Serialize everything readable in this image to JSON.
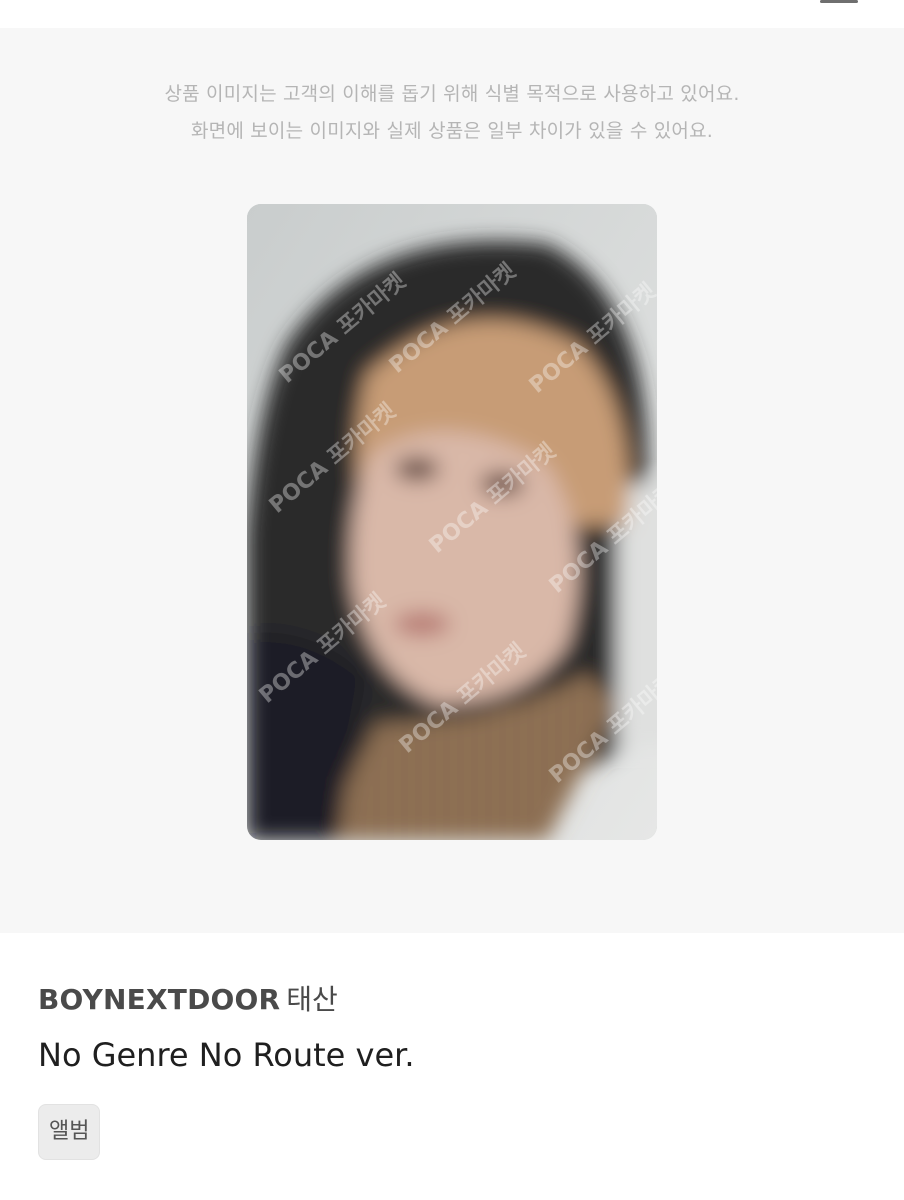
{
  "notice": {
    "line1": "상품 이미지는 고객의 이해를 돕기 위해 식별 목적으로 사용하고 있어요.",
    "line2": "화면에 보이는 이미지와 실제 상품은 일부 차이가 있을 수 있어요."
  },
  "product_image": {
    "watermark": "POCA 포카마켓"
  },
  "product": {
    "artist": "BOYNEXTDOOR",
    "member": "태산",
    "version": "No Genre No Route ver.",
    "tag": "앨범"
  }
}
